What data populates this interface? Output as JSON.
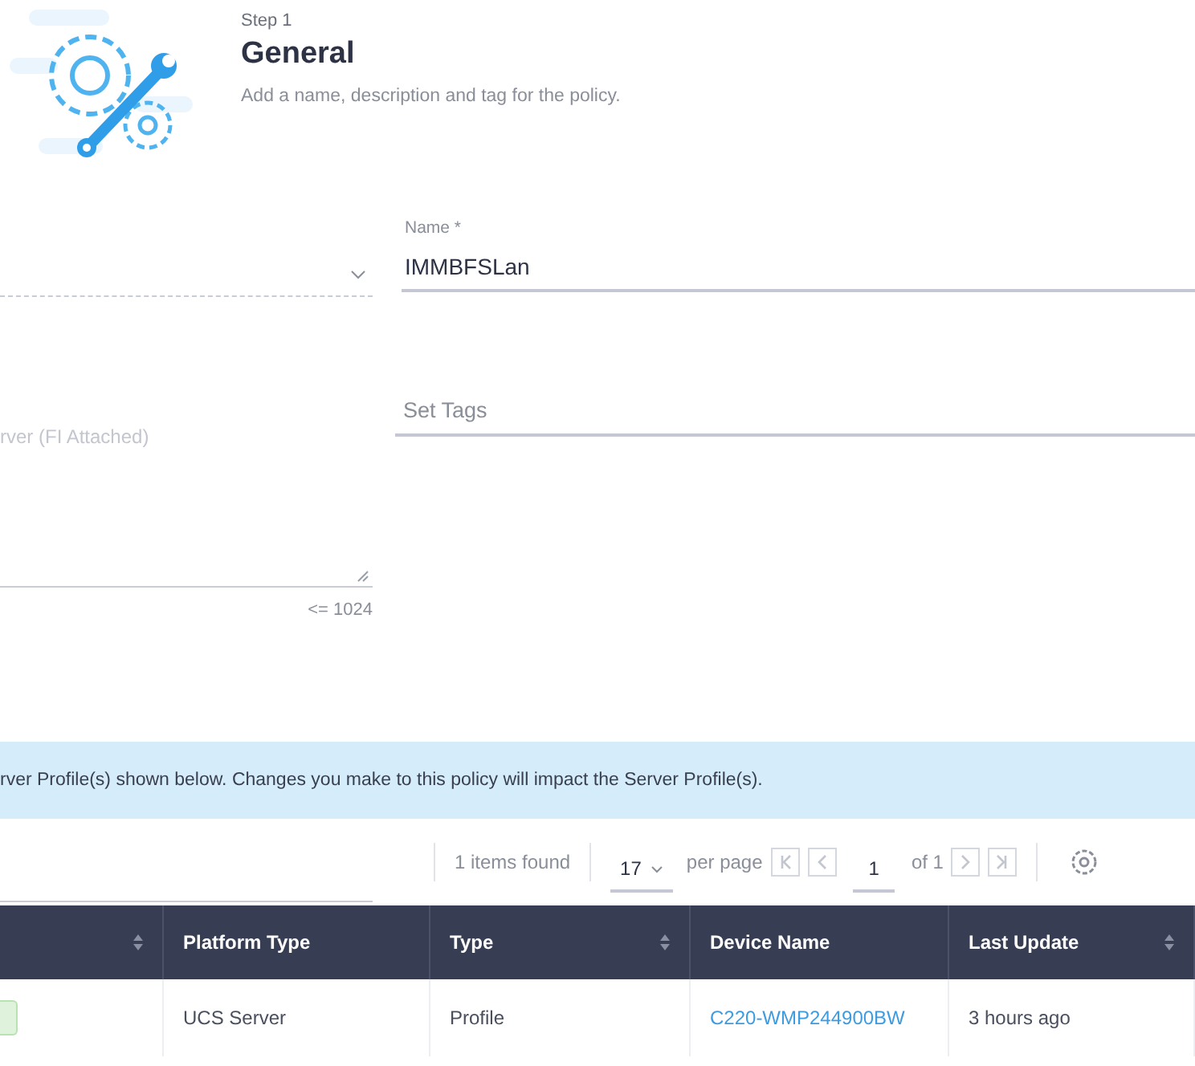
{
  "header": {
    "step": "Step 1",
    "title": "General",
    "subtitle": "Add a name, description and tag for the policy."
  },
  "form": {
    "name": {
      "label": "Name *",
      "value": "IMMBFSLan"
    },
    "description": {
      "placeholder": "rver (FI Attached)",
      "limit": "<= 1024"
    },
    "tags": {
      "placeholder": "Set Tags"
    }
  },
  "banner": "rver Profile(s) shown below. Changes you make to this policy will impact the Server Profile(s).",
  "pagination": {
    "count": "1 items found",
    "per_page_value": "17",
    "per_page_label": "per page",
    "page": "1",
    "of": "of 1"
  },
  "table": {
    "columns": [
      {
        "sortable": true
      },
      {
        "label": "Platform Type",
        "sortable": false
      },
      {
        "label": "Type",
        "sortable": true
      },
      {
        "label": "Device Name",
        "sortable": false
      },
      {
        "label": "Last Update",
        "sortable": true
      }
    ],
    "rows": [
      {
        "cells": [
          {
            "kind": "status"
          },
          {
            "kind": "text",
            "text": "UCS Server"
          },
          {
            "kind": "text",
            "text": "Profile"
          },
          {
            "kind": "link",
            "text": "C220-WMP244900BW"
          },
          {
            "kind": "text",
            "text": "3 hours ago"
          }
        ]
      }
    ]
  }
}
